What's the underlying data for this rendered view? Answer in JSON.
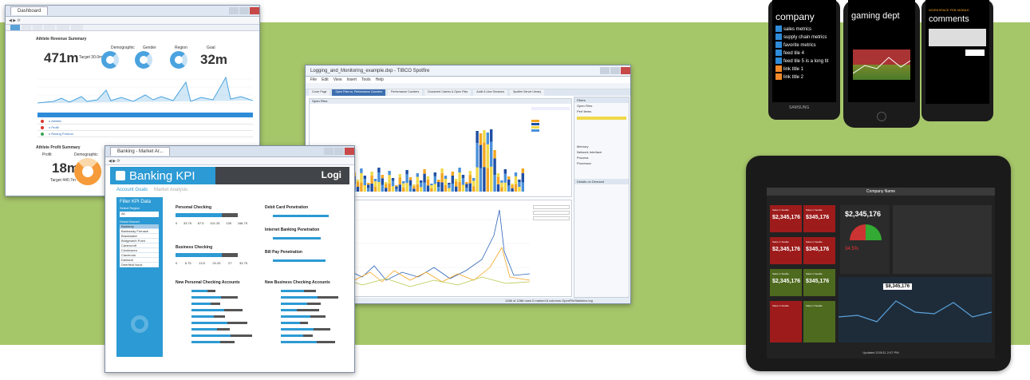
{
  "window1": {
    "tab_label": "Dashboard",
    "section_title": "Athlete Revenue Summary",
    "kpi_revenue": "471m",
    "kpi_goal": "32m",
    "donut_titles": [
      "Demographic",
      "Gender",
      "Region",
      "Goal"
    ],
    "target_label": "Target 30.0m",
    "table_rows": [
      {
        "label": "n Athletic",
        "color": "#d9342b"
      },
      {
        "label": "n Profit",
        "color": "#d9342b"
      },
      {
        "label": "n Racing Product",
        "color": "#3aa657"
      }
    ],
    "profit_section": "Athlete Profit Summary",
    "kpi_profit": "18m",
    "profit_label": "Profit",
    "profit_target": "Target 440.7m",
    "demographic_label": "Demographic"
  },
  "window2": {
    "tab_label": "Banking - Market Ar...",
    "title": "Banking KPI",
    "brand": "Logi",
    "tabs": [
      "Account Goals",
      "Market Analysis"
    ],
    "sidebar_title": "Filter KPI Data",
    "sidebar_sub": "Select Region",
    "sidebar_select": "All",
    "sidebar_sub2": "Select Branch",
    "branches": [
      "Baddeny",
      "Banksway Furnace",
      "Brackwater",
      "Bridgewich Point",
      "Cartercroft",
      "Crickhaven",
      "Claverook",
      "Danland",
      "Deerfield Nook"
    ],
    "panels": {
      "personal_checking": "Personal Checking",
      "debit_card": "Debit Card Penetration",
      "business_checking": "Business Checking",
      "internet_banking": "Internet Banking Penetration",
      "bill_pay": "Bill Pay Penetration",
      "new_personal": "New Personal Checking Accounts",
      "new_business": "New Business Checking Accounts"
    },
    "axis_personal": [
      "0",
      "33.75",
      "67.5",
      "101.25",
      "135",
      "168.75"
    ],
    "axis_business": [
      "0",
      "6.75",
      "13.5",
      "20.25",
      "27",
      "33.75"
    ]
  },
  "window3": {
    "title": "Logging_and_Monitoring_example.dxp - TIBCO Spotfire",
    "menu": [
      "File",
      "Edit",
      "View",
      "Insert",
      "Tools",
      "Help"
    ],
    "tabs": [
      "Cover Page",
      "Open Files vs. Performance Counters",
      "Performance Counters",
      "Document Caches & Open Files",
      "Audit & User Sessions",
      "Spotfire Server Library"
    ],
    "top_pane": "Open Files",
    "filters_title": "Filters",
    "filters_items": [
      "Open Files",
      "Perf Items",
      "Memory",
      "Network Interface",
      "Process",
      "Processor"
    ],
    "details_title": "Details on Demand",
    "status": "1286 of 1286 rows   0 marked   8 columns   OpenFileStatistics.log"
  },
  "phones": {
    "phone1_title": "company",
    "phone1_items": [
      "sales metrics",
      "supply chain metrics",
      "favorite metrics",
      "feed tile 4",
      "feed tile 5 is a long tit",
      "link title 1",
      "link title 2"
    ],
    "phone2_title": "gaming dept",
    "phone3_title": "comments",
    "phone3_sub": "WORKSPACE FEB MOBILE",
    "phone_brand": "SAMSUNG"
  },
  "tablet": {
    "title": "Company Name",
    "value_main": "$2,345,176",
    "value_mid": "$8,345,176",
    "tile_values": [
      "$2,345,176",
      "$2,345,176",
      "$2,345,176",
      "$345,176",
      "$345,176",
      "$345,176"
    ],
    "tile_label": "Sales in Seattle",
    "pct": "34.5%",
    "footer": "Updated 2/15/11 2:07 PM"
  },
  "colors": {
    "band": "#a6c66a",
    "accent_blue": "#2c9ad4",
    "spotfire_orange": "#f5a623"
  }
}
